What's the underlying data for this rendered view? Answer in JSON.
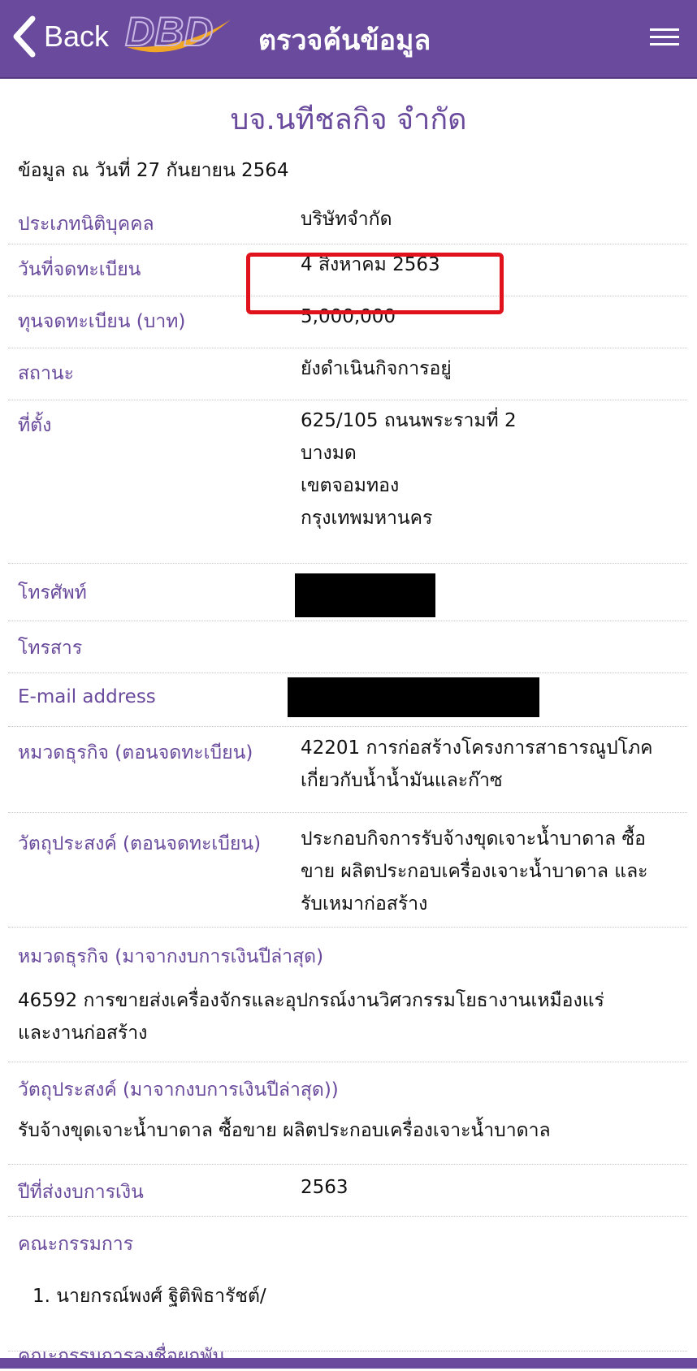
{
  "header": {
    "back_label": "Back",
    "logo_text": "DBD",
    "title": "ตรวจค้นข้อมูล"
  },
  "company_name": "บจ.นทีชลกิจ จำกัด",
  "as_of": "ข้อมูล ณ วันที่ 27 กันยายน 2564",
  "fields": {
    "type": {
      "label": "ประเภทนิติบุคคล",
      "value": "บริษัทจำกัด"
    },
    "reg_date": {
      "label": "วันที่จดทะเบียน",
      "value": "4 สิงหาคม 2563"
    },
    "capital": {
      "label": "ทุนจดทะเบียน (บาท)",
      "value": "5,000,000"
    },
    "status": {
      "label": "สถานะ",
      "value": "ยังดำเนินกิจการอยู่"
    },
    "address": {
      "label": "ที่ตั้ง",
      "lines": [
        "625/105 ถนนพระรามที่ 2",
        "บางมด",
        "เขตจอมทอง",
        "กรุงเทพมหานคร"
      ]
    },
    "phone": {
      "label": "โทรศัพท์"
    },
    "fax": {
      "label": "โทรสาร"
    },
    "email": {
      "label": "E-mail address"
    },
    "biz_reg": {
      "label": "หมวดธุรกิจ (ตอนจดทะเบียน)",
      "lines": [
        "42201 การก่อสร้างโครงการสาธารณูปโภค",
        "เกี่ยวกับน้ำน้ำมันและก๊าซ"
      ]
    },
    "obj_reg": {
      "label": "วัตถุประสงค์ (ตอนจดทะเบียน)",
      "lines": [
        "ประกอบกิจการรับจ้างขุดเจาะน้ำบาดาล ซื้อ",
        "ขาย ผลิตประกอบเครื่องเจาะน้ำบาดาล และ",
        "รับเหมาก่อสร้าง"
      ]
    },
    "biz_latest": {
      "label": "หมวดธุรกิจ (มาจากงบการเงินปีล่าสุด)",
      "lines": [
        "46592 การขายส่งเครื่องจักรและอุปกรณ์งานวิศวกรรมโยธางานเหมืองแร่",
        "และงานก่อสร้าง"
      ]
    },
    "obj_latest": {
      "label": "วัตถุประสงค์ (มาจากงบการเงินปีล่าสุด))",
      "value": "รับจ้างขุดเจาะน้ำบาดาล ซื้อขาย ผลิตประกอบเครื่องเจาะน้ำบาดาล"
    },
    "fin_year": {
      "label": "ปีที่ส่งงบการเงิน",
      "value": "2563"
    },
    "directors": {
      "label": "คณะกรรมการ",
      "items": [
        "1. นายกรณ์พงศ์ ฐิติพิธารัชต์/"
      ]
    },
    "signing": {
      "label": "คณะกรรมการลงชื่อผูกพัน"
    }
  },
  "colors": {
    "accent": "#6a4a9c",
    "highlight": "#e0121b"
  }
}
